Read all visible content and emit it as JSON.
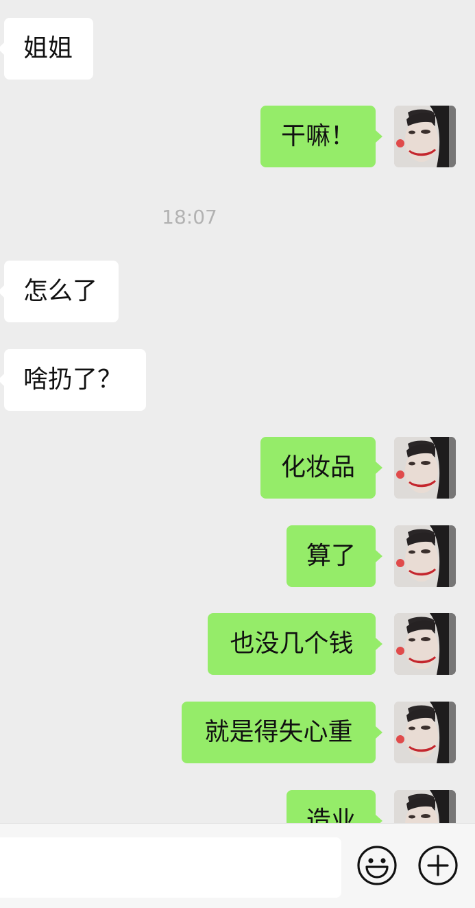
{
  "messages": [
    {
      "side": "in",
      "text": "姐姐"
    },
    {
      "side": "out",
      "text": "干嘛！"
    },
    {
      "type": "time",
      "text": "18:07"
    },
    {
      "side": "in",
      "text": "怎么了"
    },
    {
      "side": "in",
      "text": "啥扔了？"
    },
    {
      "side": "out",
      "text": "化妆品"
    },
    {
      "side": "out",
      "text": "算了"
    },
    {
      "side": "out",
      "text": "也没几个钱"
    },
    {
      "side": "out",
      "text": "就是得失心重"
    },
    {
      "side": "out",
      "text": "造业"
    }
  ],
  "input": {
    "value": "",
    "placeholder": ""
  },
  "icons": {
    "emoji": "smiley-face-icon",
    "more": "plus-circle-icon"
  },
  "colors": {
    "background": "#ededed",
    "incoming_bubble": "#ffffff",
    "outgoing_bubble": "#95ec69",
    "timestamp": "#b2b2b2"
  }
}
